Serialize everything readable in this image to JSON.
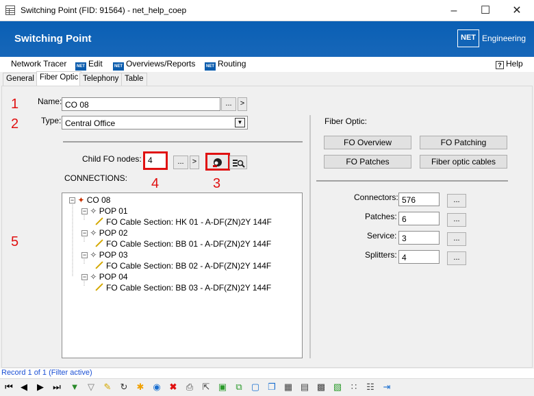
{
  "window": {
    "title": "Switching Point (FID: 91564) - net_help_coep"
  },
  "header": {
    "title": "Switching Point",
    "logo_text": "NET",
    "brand_text": "Engineering"
  },
  "menu": {
    "network_tracer": "Network Tracer",
    "edit": "Edit",
    "overviews": "Overviews/Reports",
    "routing": "Routing",
    "help": "Help"
  },
  "tabs": [
    "General",
    "Fiber Optic",
    "Telephony",
    "Table"
  ],
  "markers": [
    "1",
    "2",
    "3",
    "4",
    "5"
  ],
  "form": {
    "name_label": "Name:",
    "name_value": "CO 08",
    "type_label": "Type:",
    "type_value": "Central Office",
    "child_label": "Child FO nodes:",
    "child_value": "4",
    "connections_label": "CONNECTIONS:",
    "ellipsis": "...",
    "arrow": ">"
  },
  "tree": [
    {
      "label": "CO 08",
      "level": 0,
      "kind": "root"
    },
    {
      "label": "POP 01",
      "level": 1,
      "kind": "pop"
    },
    {
      "label": "FO Cable Section: HK 01 - A-DF(ZN)2Y 144F",
      "level": 2,
      "kind": "cable"
    },
    {
      "label": "POP 02",
      "level": 1,
      "kind": "pop"
    },
    {
      "label": "FO Cable Section: BB 01 - A-DF(ZN)2Y 144F",
      "level": 2,
      "kind": "cable"
    },
    {
      "label": "POP 03",
      "level": 1,
      "kind": "pop"
    },
    {
      "label": "FO Cable Section: BB 02 - A-DF(ZN)2Y 144F",
      "level": 2,
      "kind": "cable"
    },
    {
      "label": "POP 04",
      "level": 1,
      "kind": "pop"
    },
    {
      "label": "FO Cable Section: BB 03 - A-DF(ZN)2Y 144F",
      "level": 2,
      "kind": "cable"
    }
  ],
  "fiber": {
    "title": "Fiber Optic:",
    "buttons": [
      "FO Overview",
      "FO Patching",
      "FO Patches",
      "Fiber optic cables"
    ],
    "stats": [
      {
        "label": "Connectors:",
        "value": "576"
      },
      {
        "label": "Patches:",
        "value": "6"
      },
      {
        "label": "Service:",
        "value": "3"
      },
      {
        "label": "Splitters:",
        "value": "4"
      }
    ]
  },
  "status": {
    "text": "Record 1 of 1 (Filter active)"
  },
  "colors": {
    "header": "#1767b9",
    "marker": "#e01010",
    "status_text": "#1a4fd4"
  }
}
